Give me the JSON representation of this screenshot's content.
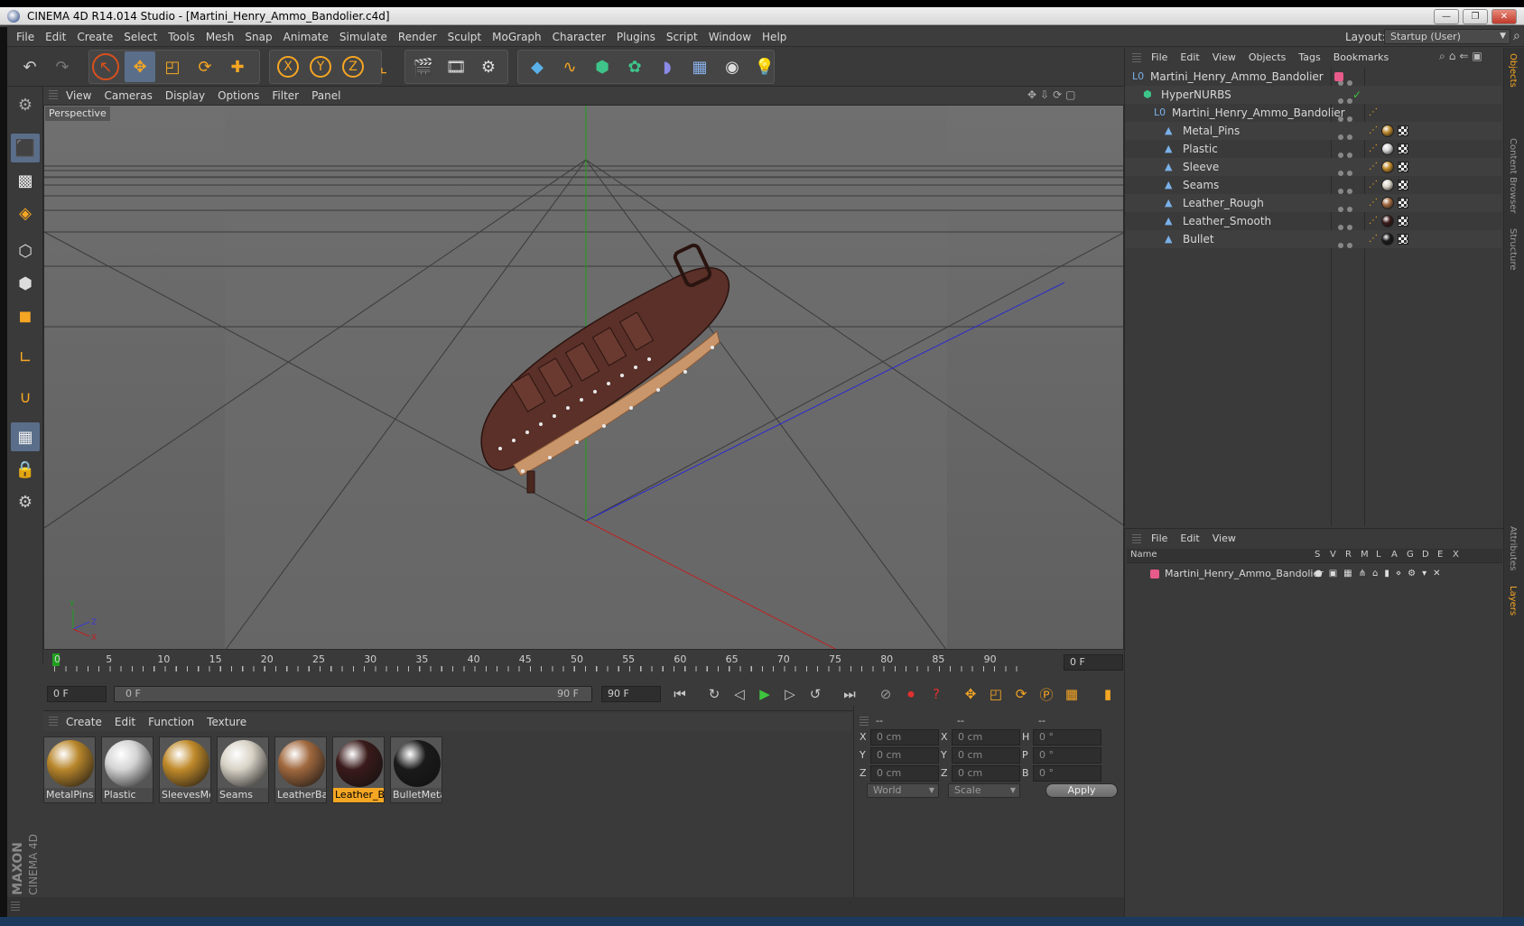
{
  "window": {
    "title": "CINEMA 4D R14.014 Studio - [Martini_Henry_Ammo_Bandolier.c4d]",
    "minimize": "—",
    "maximize": "❐",
    "close": "✕"
  },
  "menubar": {
    "items": [
      "File",
      "Edit",
      "Create",
      "Select",
      "Tools",
      "Mesh",
      "Snap",
      "Animate",
      "Simulate",
      "Render",
      "Sculpt",
      "MoGraph",
      "Character",
      "Plugins",
      "Script",
      "Window",
      "Help"
    ],
    "layout_label": "Layout:",
    "layout_value": "Startup (User)"
  },
  "viewport": {
    "menu": [
      "View",
      "Cameras",
      "Display",
      "Options",
      "Filter",
      "Panel"
    ],
    "camera_label": "Perspective"
  },
  "timeline": {
    "ticks": [
      "0",
      "5",
      "10",
      "15",
      "20",
      "25",
      "30",
      "35",
      "40",
      "45",
      "50",
      "55",
      "60",
      "65",
      "70",
      "75",
      "80",
      "85",
      "90"
    ],
    "current_frame": "0 F",
    "start_field": "0 F",
    "range_start": "0 F",
    "range_end": "90 F",
    "end_field": "90 F"
  },
  "materials": {
    "menu": [
      "Create",
      "Edit",
      "Function",
      "Texture"
    ],
    "items": [
      {
        "label": "MetalPins",
        "color": "#b8862b"
      },
      {
        "label": "Plastic",
        "color": "#d4d4d4"
      },
      {
        "label": "SleevesMet",
        "color": "#c08a2a"
      },
      {
        "label": "Seams",
        "color": "#d8d2c6"
      },
      {
        "label": "LeatherBac",
        "color": "#a0683e"
      },
      {
        "label": "Leather_Br",
        "color": "#3a1a1a"
      },
      {
        "label": "BulletMeta",
        "color": "#1a1a1a"
      }
    ],
    "selected_index": 5
  },
  "coordinates": {
    "headers": [
      "--",
      "--",
      "--"
    ],
    "rows": [
      {
        "a": "X",
        "av": "0 cm",
        "b": "X",
        "bv": "0 cm",
        "c": "H",
        "cv": "0 °"
      },
      {
        "a": "Y",
        "av": "0 cm",
        "b": "Y",
        "bv": "0 cm",
        "c": "P",
        "cv": "0 °"
      },
      {
        "a": "Z",
        "av": "0 cm",
        "b": "Z",
        "bv": "0 cm",
        "c": "B",
        "cv": "0 °"
      }
    ],
    "mode1": "World",
    "mode2": "Scale",
    "apply": "Apply"
  },
  "objects": {
    "menu": [
      "File",
      "Edit",
      "View",
      "Objects",
      "Tags",
      "Bookmarks"
    ],
    "tree": [
      {
        "name": "Martini_Henry_Ammo_Bandolier",
        "depth": 0
      },
      {
        "name": "HyperNURBS",
        "depth": 1
      },
      {
        "name": "Martini_Henry_Ammo_Bandolier",
        "depth": 2
      },
      {
        "name": "Metal_Pins",
        "depth": 3,
        "mat": "#b8862b"
      },
      {
        "name": "Plastic",
        "depth": 3,
        "mat": "#d4d4d4"
      },
      {
        "name": "Sleeve",
        "depth": 3,
        "mat": "#c08a2a"
      },
      {
        "name": "Seams",
        "depth": 3,
        "mat": "#d8d2c6"
      },
      {
        "name": "Leather_Rough",
        "depth": 3,
        "mat": "#a0683e"
      },
      {
        "name": "Leather_Smooth",
        "depth": 3,
        "mat": "#3a1a1a"
      },
      {
        "name": "Bullet",
        "depth": 3,
        "mat": "#1a1a1a"
      }
    ]
  },
  "layers": {
    "menu": [
      "File",
      "Edit",
      "View"
    ],
    "columns": [
      "Name",
      "S",
      "V",
      "R",
      "M",
      "L",
      "A",
      "G",
      "D",
      "E",
      "X"
    ],
    "rows": [
      {
        "name": "Martini_Henry_Ammo_Bandolier",
        "color": "#e85a8a"
      }
    ]
  },
  "sidetabs": [
    "Objects",
    "Content Browser",
    "Structure",
    "Attributes",
    "Layers"
  ],
  "brand": {
    "line1": "MAXON",
    "line2": "CINEMA 4D"
  },
  "colors": {
    "accent": "#f5a623",
    "panel": "#3a3a3a",
    "viewport": "#6a6a6a"
  }
}
